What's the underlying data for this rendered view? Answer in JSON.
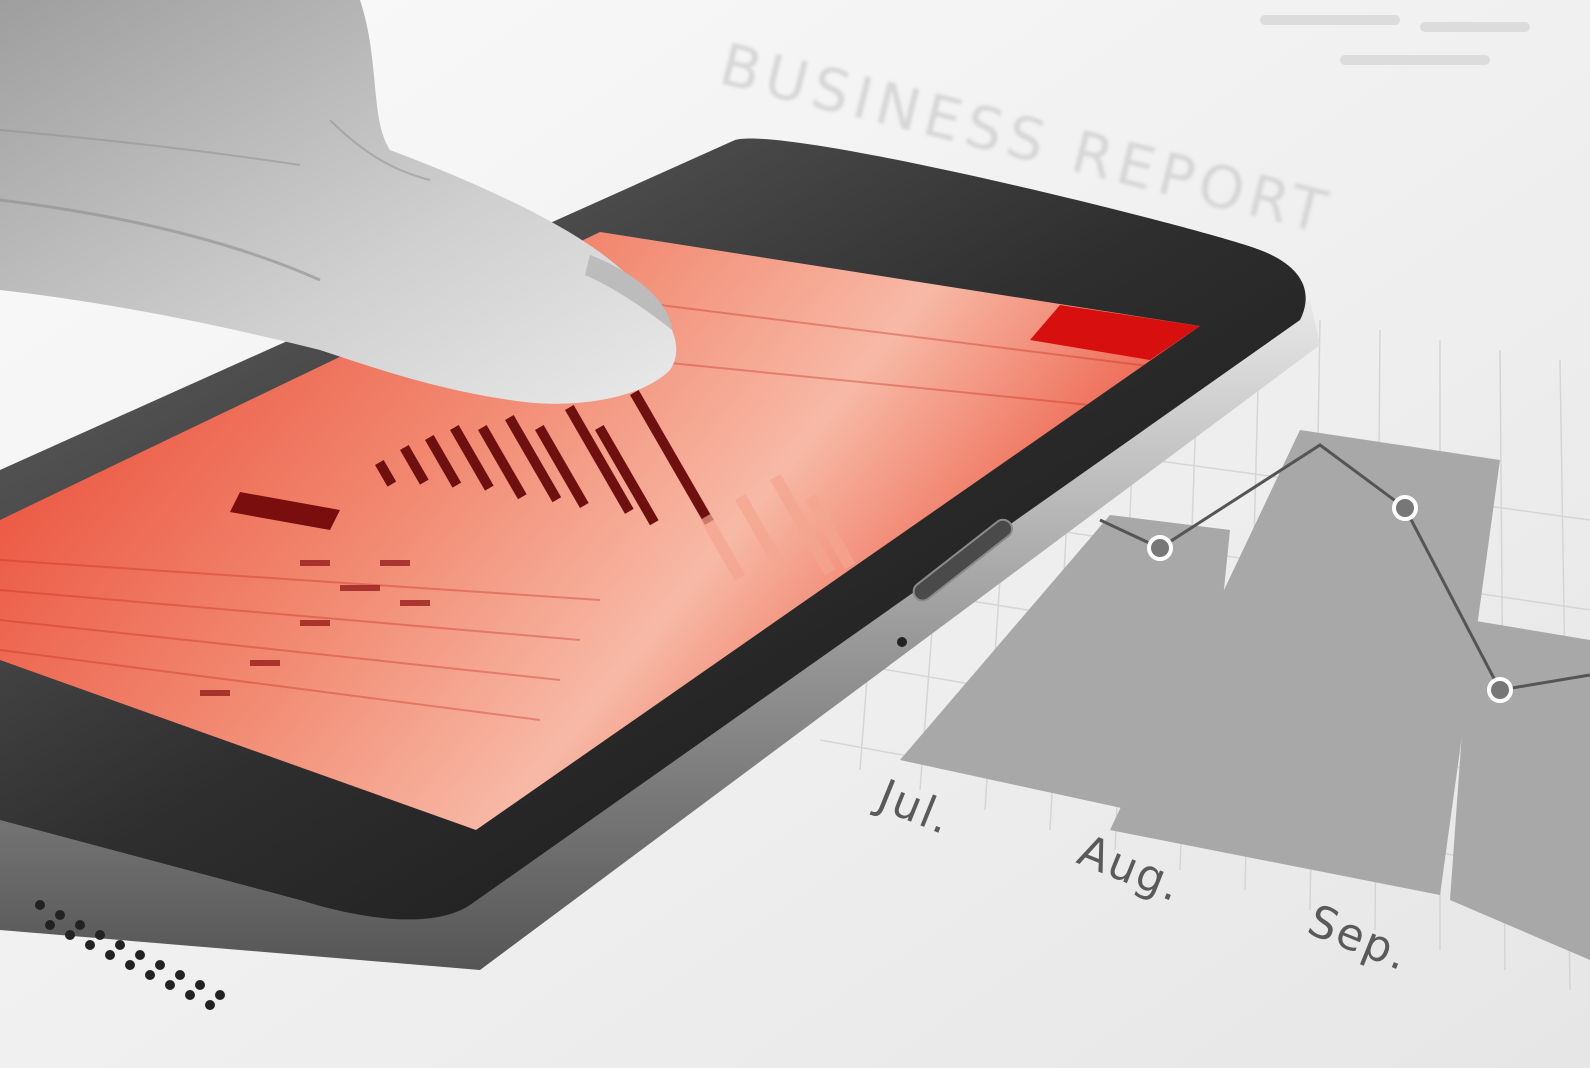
{
  "paper": {
    "title": "BUSINESS REPORT",
    "month_labels": [
      "Jul.",
      "Aug.",
      "Sep."
    ]
  },
  "colors": {
    "screen_red": "#e8402c",
    "screen_red_light": "#f6b7a5",
    "paper": "#f2f2f2",
    "phone_body": "#3a3a3a",
    "phone_edge": "#bdbdbd"
  }
}
